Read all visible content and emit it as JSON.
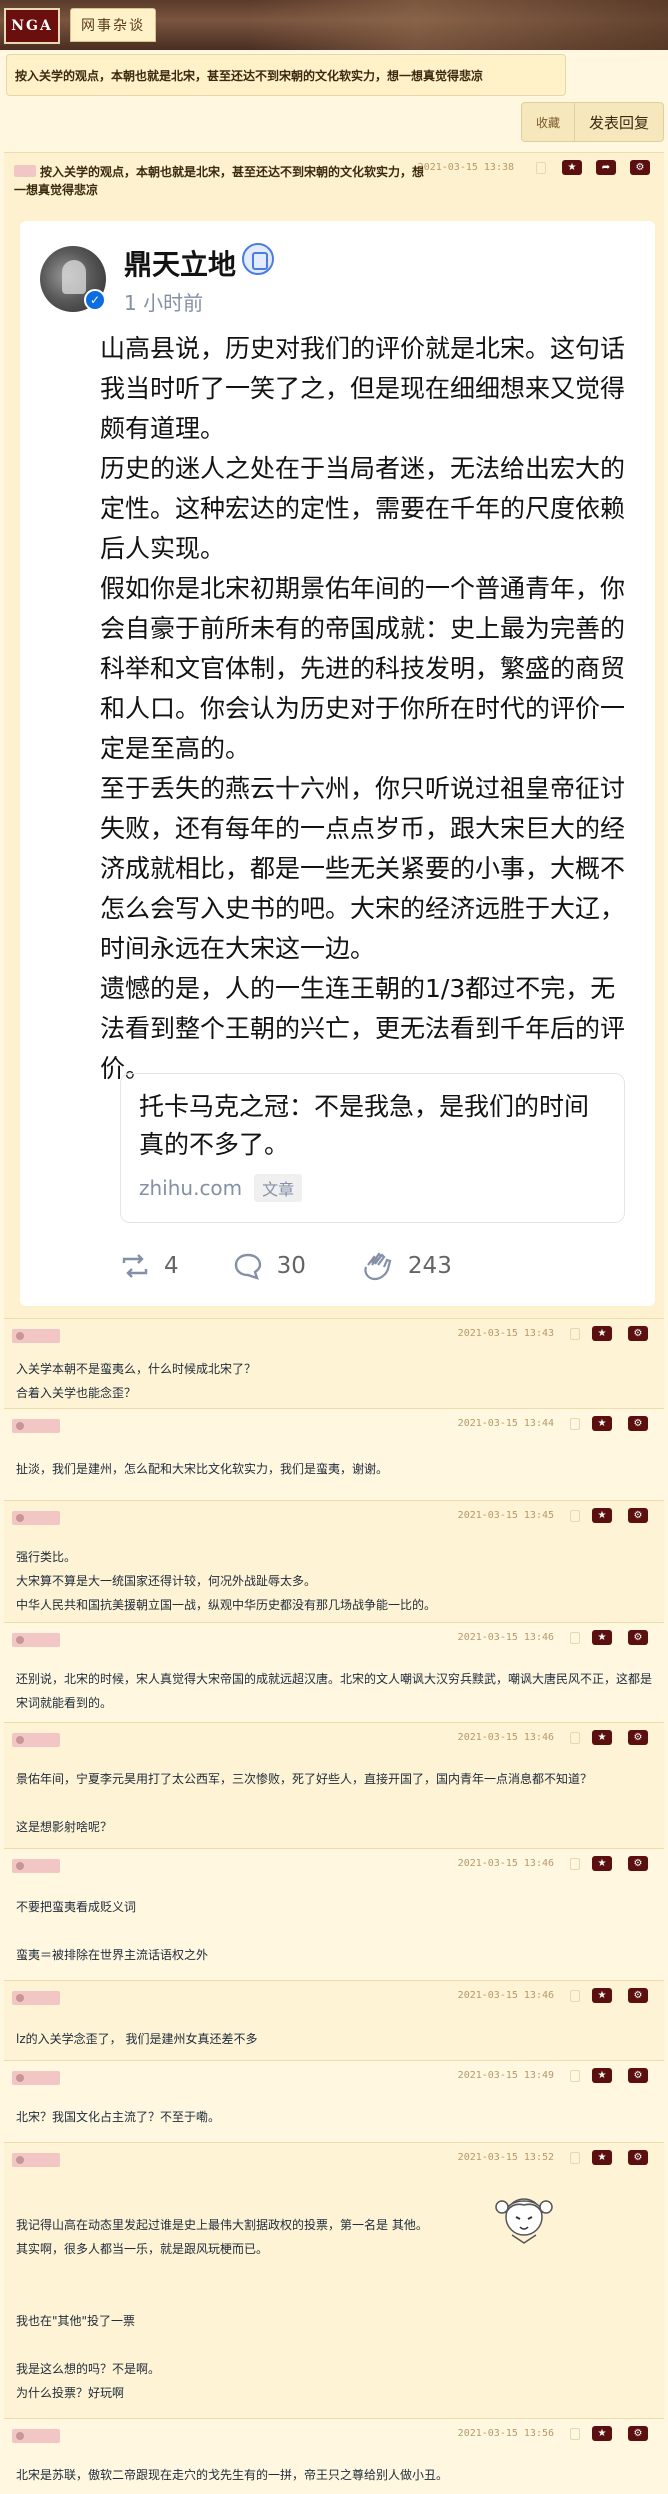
{
  "header": {
    "logo": "NGA",
    "forum_tab": "网事杂谈"
  },
  "thread": {
    "title": "按入关学的观点，本朝也就是北宋，甚至还达不到宋朝的文化软实力，想一想真觉得悲凉"
  },
  "actions": {
    "favorite": "收藏",
    "reply": "发表回复"
  },
  "main_post": {
    "title": "按入关学的观点，本朝也就是北宋，甚至还达不到宋朝的文化软实力，想一想真觉得悲凉",
    "time": "2021-03-15 13:38",
    "card": {
      "author": "鼎天立地",
      "ago": "1 小时前",
      "paragraphs": [
        "山高县说，历史对我们的评价就是北宋。这句话我当时听了一笑了之，但是现在细细想来又觉得颇有道理。",
        "历史的迷人之处在于当局者迷，无法给出宏大的定性。这种宏达的定性，需要在千年的尺度依赖后人实现。",
        "假如你是北宋初期景佑年间的一个普通青年，你会自豪于前所未有的帝国成就：史上最为完善的科举和文官体制，先进的科技发明，繁盛的商贸和人口。你会认为历史对于你所在时代的评价一定是至高的。",
        "至于丢失的燕云十六州，你只听说过祖皇帝征讨失败，还有每年的一点点岁币，跟大宋巨大的经济成就相比，都是一些无关紧要的小事，大概不怎么会写入史书的吧。大宋的经济远胜于大辽，时间永远在大宋这一边。",
        "遗憾的是，人的一生连王朝的1/3都过不完，无法看到整个王朝的兴亡，更无法看到千年后的评价。"
      ],
      "quote": {
        "text": "托卡马克之冠：不是我急，是我们的时间真的不多了。",
        "source": "zhihu.com",
        "badge": "文章"
      },
      "stats": {
        "reposts": "4",
        "comments": "30",
        "likes": "243"
      }
    }
  },
  "replies": [
    {
      "time": "2021-03-15 13:43",
      "text": "入关学本朝不是蛮夷么，什么时候成北宋了？\n合着入关学也能念歪？"
    },
    {
      "time": "2021-03-15 13:44",
      "text": "扯淡，我们是建州，怎么配和大宋比文化软实力，我们是蛮夷，谢谢。"
    },
    {
      "time": "2021-03-15 13:45",
      "text": "强行类比。\n大宋算不算是大一统国家还得计较，何况外战趾辱太多。\n中华人民共和国抗美援朝立国一战，纵观中华历史都没有那几场战争能一比的。"
    },
    {
      "time": "2021-03-15 13:46",
      "text": "还别说，北宋的时候，宋人真觉得大宋帝国的成就远超汉唐。北宋的文人嘲讽大汉穷兵黩武，嘲讽大唐民风不正，这都是宋词就能看到的。"
    },
    {
      "time": "2021-03-15 13:46",
      "text": "景佑年间，宁夏李元昊用打了太公西军，三次惨败，死了好些人，直接开国了，国内青年一点消息都不知道？\n\n这是想影射啥呢？"
    },
    {
      "time": "2021-03-15 13:46",
      "text": "不要把蛮夷看成贬义词\n\n蛮夷＝被排除在世界主流话语权之外"
    },
    {
      "time": "2021-03-15 13:46",
      "text": "lz的入关学念歪了， 我们是建州女真还差不多"
    },
    {
      "time": "2021-03-15 13:49",
      "text": "北宋？我国文化占主流了？不至于嘞。"
    },
    {
      "time": "2021-03-15 13:52",
      "text": "我记得山高在动态里发起过谁是史上最伟大割据政权的投票，第一名是 其他。\n其实啊，很多人都当一乐，就是跟风玩梗而已。\n\n\n我也在\"其他\"投了一票\n\n我是这么想的吗？不是啊。\n为什么投票？好玩啊"
    },
    {
      "time": "2021-03-15 13:56",
      "text": "北宋是苏联，傲软二帝跟现在走穴的戈先生有的一拼，帝王只之尊给别人做小丑。"
    }
  ]
}
